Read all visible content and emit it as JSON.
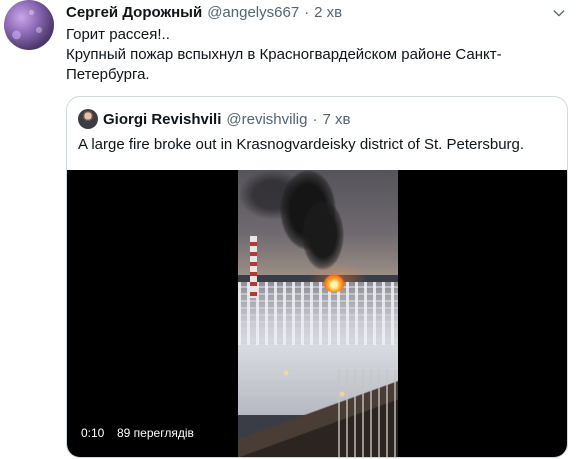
{
  "tweet": {
    "author_name": "Сергей Дорожный",
    "handle": "@angelys667",
    "separator": "·",
    "time": "2 хв",
    "text_lines": [
      "Горит рассея!..",
      "Крупный пожар вспыхнул в Красногвардейском районе Санкт-",
      "Петербурга."
    ],
    "menu_icon": "chevron-down-icon",
    "avatar_icon": "avatar"
  },
  "quoted_tweet": {
    "author_name": "Giorgi Revishvili",
    "handle": "@revishvilig",
    "separator": "·",
    "time": "7 хв",
    "text": "A large fire broke out in Krasnogvardeisky district of St. Petersburg.",
    "avatar_icon": "avatar"
  },
  "video": {
    "duration": "0:10",
    "views": "89 переглядів"
  }
}
